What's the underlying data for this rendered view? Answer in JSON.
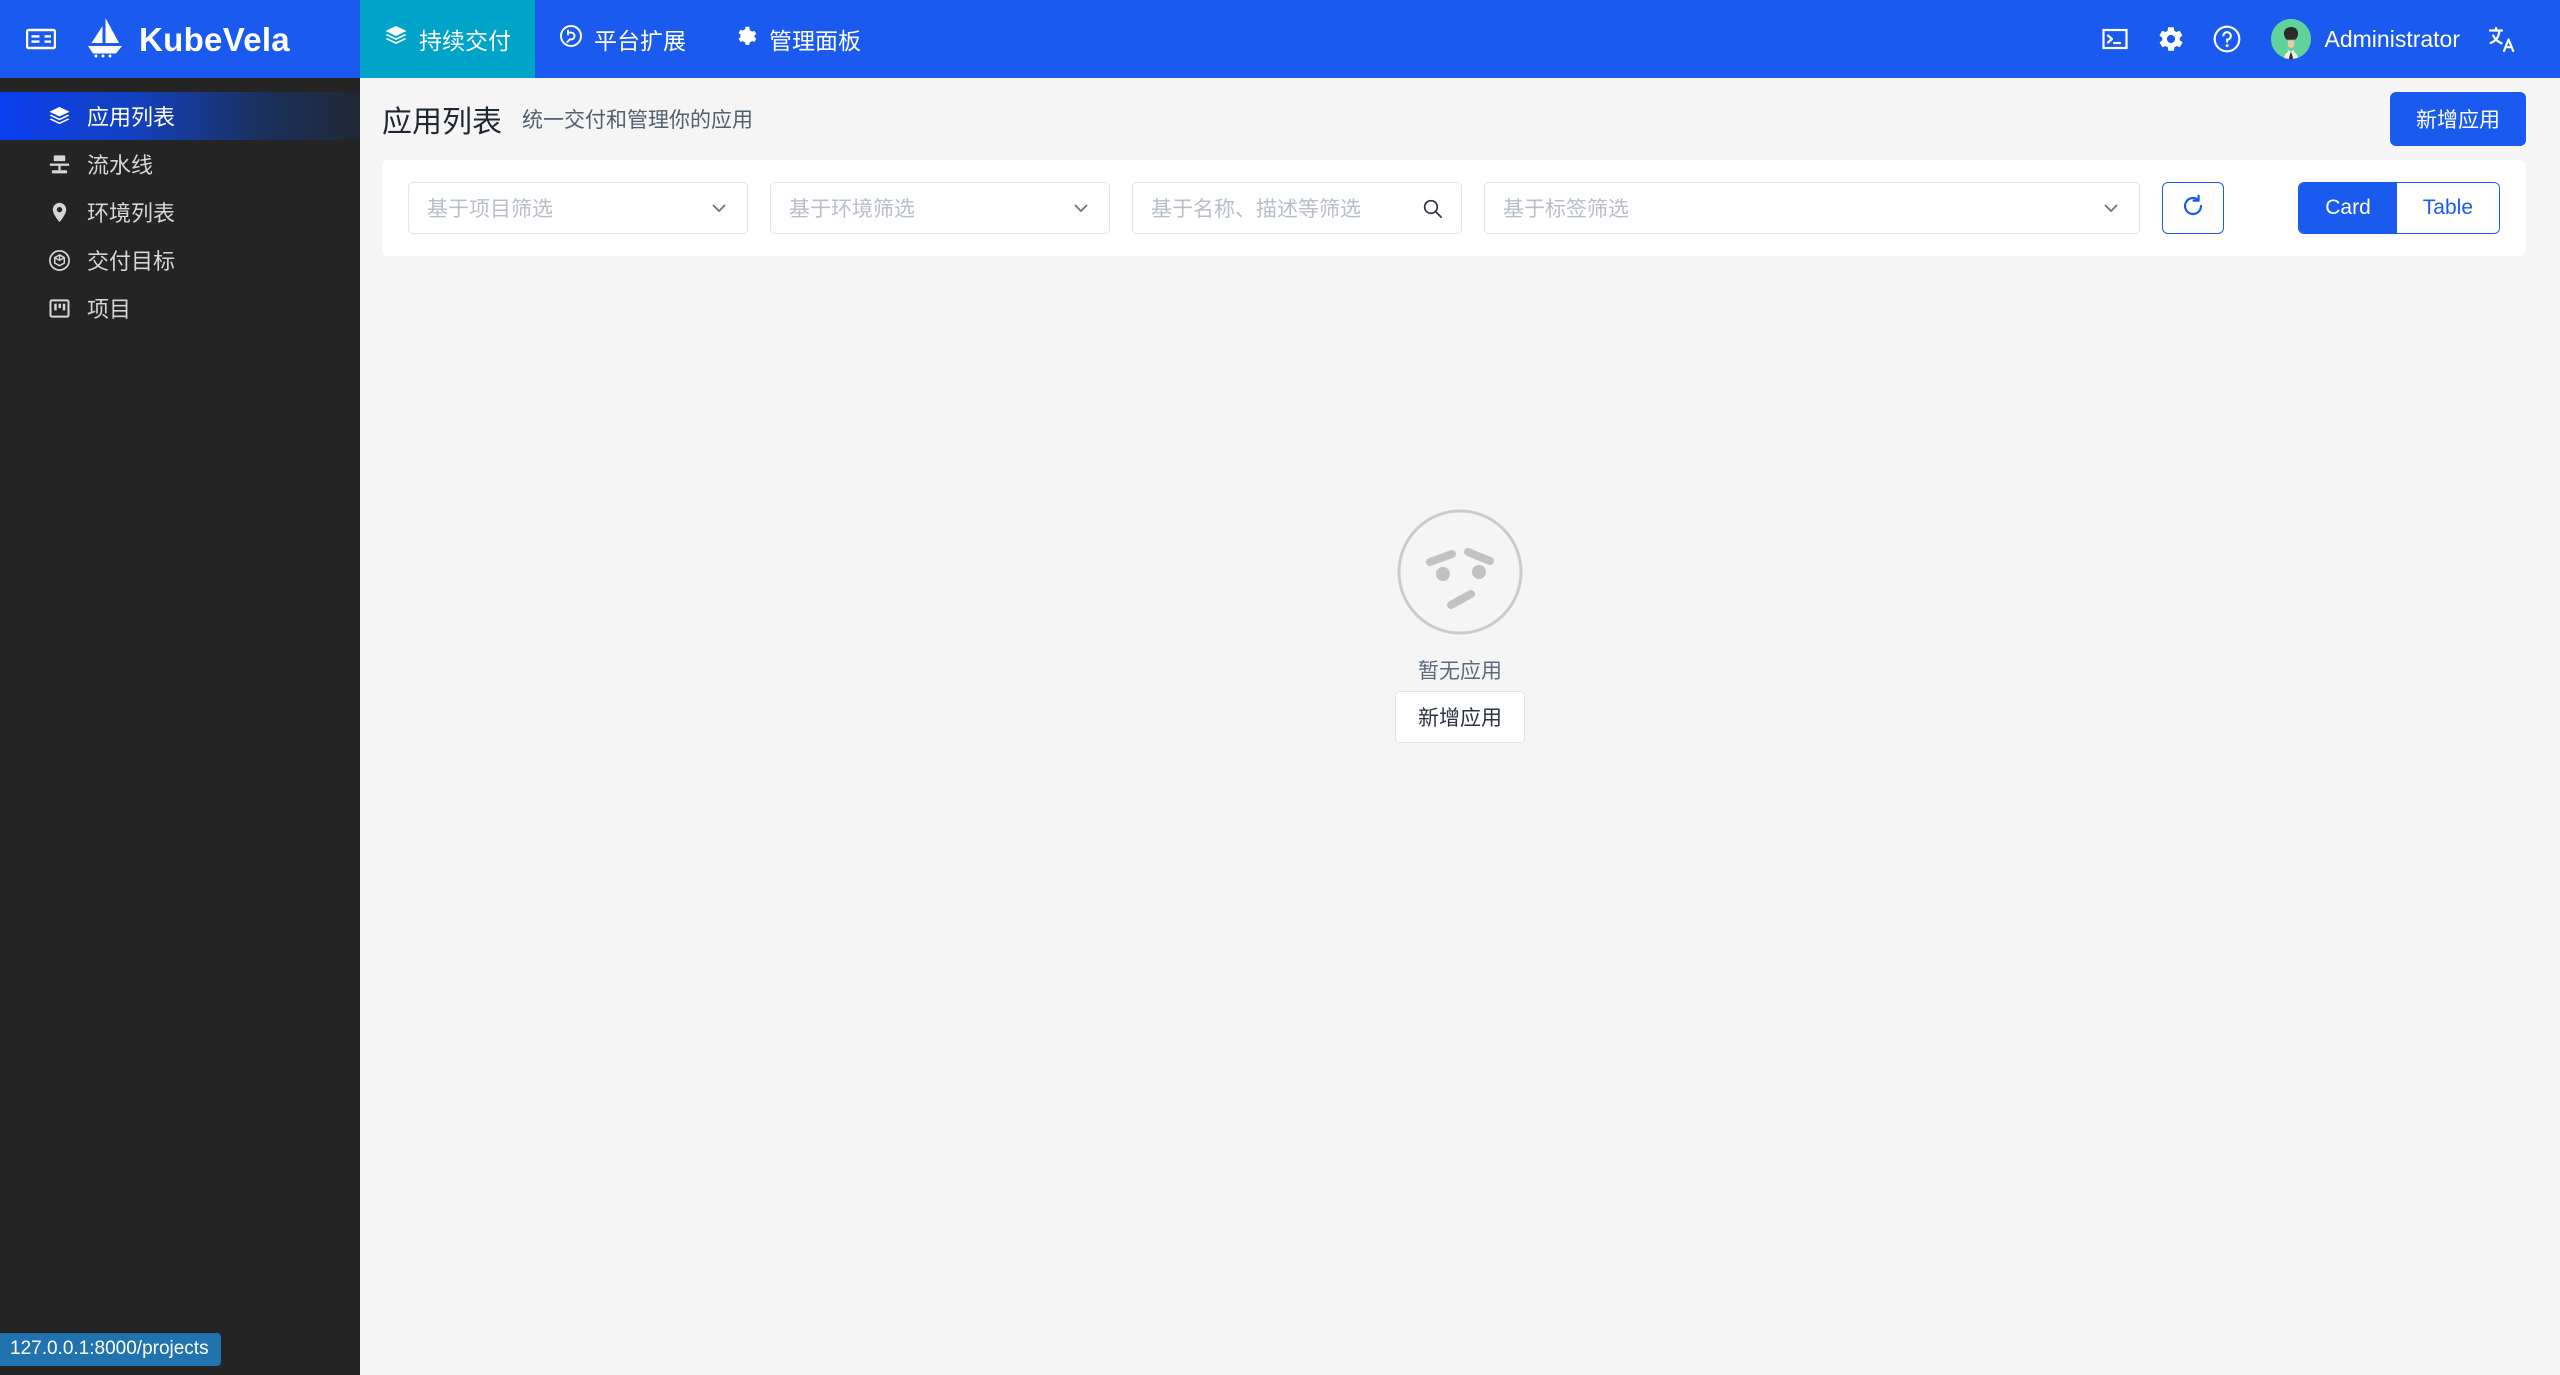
{
  "header": {
    "collapse_icon": "sidebar-toggle-icon",
    "logo_icon": "sailboat-logo-icon",
    "brand": "KubeVela",
    "nav_tabs": [
      {
        "label": "持续交付",
        "icon": "layers-icon",
        "active": true
      },
      {
        "label": "平台扩展",
        "icon": "plug-icon",
        "active": false
      },
      {
        "label": "管理面板",
        "icon": "gear-icon",
        "active": false
      }
    ],
    "actions": [
      {
        "name": "terminal-icon",
        "icon": "terminal-icon"
      },
      {
        "name": "settings-icon",
        "icon": "gear-icon"
      },
      {
        "name": "help-icon",
        "icon": "question-circle-icon"
      }
    ],
    "user": {
      "name": "Administrator",
      "avatar_icon": "user-avatar-icon"
    },
    "language_icon": "translate-icon",
    "bg_color": "#1A5AEF",
    "active_tab_color": "#00A4C8"
  },
  "sidebar": {
    "items": [
      {
        "label": "应用列表",
        "icon": "layers-icon",
        "active": true
      },
      {
        "label": "流水线",
        "icon": "pipeline-icon",
        "active": false
      },
      {
        "label": "环境列表",
        "icon": "location-pin-icon",
        "active": false
      },
      {
        "label": "交付目标",
        "icon": "cube-target-icon",
        "active": false
      },
      {
        "label": "项目",
        "icon": "project-board-icon",
        "active": false
      }
    ],
    "bg_color": "#242424"
  },
  "status_bar": {
    "url": "127.0.0.1:8000/projects"
  },
  "page": {
    "title": "应用列表",
    "subtitle": "统一交付和管理你的应用",
    "primary_button": "新增应用"
  },
  "filters": {
    "project": {
      "placeholder": "基于项目筛选",
      "value": "",
      "caret_icon": "chevron-down-icon"
    },
    "environment": {
      "placeholder": "基于环境筛选",
      "value": "",
      "caret_icon": "chevron-down-icon"
    },
    "search": {
      "placeholder": "基于名称、描述等筛选",
      "value": "",
      "icon": "search-icon"
    },
    "label": {
      "placeholder": "基于标签筛选",
      "value": "",
      "caret_icon": "chevron-down-icon"
    },
    "refresh_icon": "refresh-icon",
    "view_modes": [
      {
        "label": "Card",
        "active": true
      },
      {
        "label": "Table",
        "active": false
      }
    ]
  },
  "empty_state": {
    "illustration": "confused-face-icon",
    "message": "暂无应用",
    "action_label": "新增应用"
  },
  "colors": {
    "brand_blue": "#1A5AEF",
    "teal": "#00A4C8",
    "page_bg": "#f5f5f5",
    "sidebar_bg": "#242424",
    "status_tip": "#2173B0",
    "avatar_green": "#62D29C"
  }
}
